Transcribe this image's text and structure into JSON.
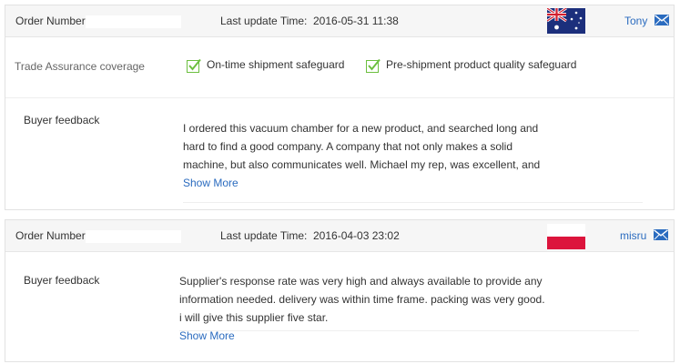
{
  "reviews": [
    {
      "order_label": "Order Number:",
      "update_label": "Last update Time:",
      "update_time": "2016-05-31 11:38",
      "country_flag": "australia-flag",
      "buyer": "Tony",
      "trade_assurance": {
        "label": "Trade Assurance coverage",
        "items": [
          "On-time shipment safeguard",
          "Pre-shipment product quality safeguard"
        ]
      },
      "feedback_label": "Buyer feedback",
      "feedback_text": "I ordered this vacuum chamber for a new product, and searched long and hard to find a good company. A company that not only makes a solid machine, but also communicates well. Michael my rep, was excellent, and was",
      "show_more": "Show More"
    },
    {
      "order_label": "Order Number:",
      "update_label": "Last update Time:",
      "update_time": "2016-04-03 23:02",
      "country_flag": "poland-flag",
      "buyer": "misru",
      "feedback_label": "Buyer feedback",
      "feedback_text": "Supplier's response rate was very high and always available to provide any information needed. delivery was within time frame. packing was very good. i will give this supplier five star.",
      "show_more": "Show More"
    }
  ],
  "colors": {
    "link": "#2a6bbf",
    "check_green": "#6cbf3f",
    "header_bg": "#f6f6f6"
  }
}
